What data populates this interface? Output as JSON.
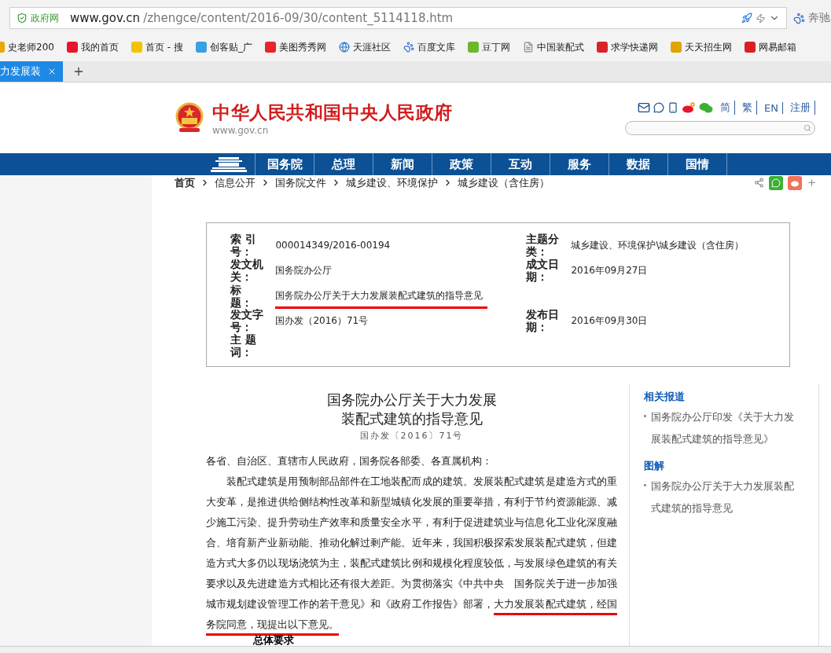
{
  "browser": {
    "site_label": "政府网",
    "url_host": "www.gov.cn",
    "url_path": "/zhengce/content/2016-09/30/content_5114118.htm",
    "search_engine": "奔驰",
    "bookmarks": [
      "史老师200",
      "我的首页",
      "首页 - 搜",
      "创客贴_广",
      "美图秀秀网",
      "天涯社区",
      "百度文库",
      "豆丁网",
      "中国装配式",
      "求学快递网",
      "天天招生网",
      "网易邮箱"
    ],
    "tabs": [
      {
        "title": "力发展装",
        "selected": true
      }
    ]
  },
  "header": {
    "site_title": "中华人民共和国中央人民政府",
    "site_domain": "www.gov.cn",
    "languages": [
      "简",
      "繁",
      "EN",
      "注册"
    ]
  },
  "nav": [
    "国务院",
    "总理",
    "新闻",
    "政策",
    "互动",
    "服务",
    "数据",
    "国情"
  ],
  "breadcrumb": [
    "首页",
    "信息公开",
    "国务院文件",
    "城乡建设、环境保护",
    "城乡建设（含住房）"
  ],
  "info": [
    {
      "label": "索 引号：",
      "value": "000014349/2016-00194",
      "right_label": "主题分类：",
      "right_value": "城乡建设、环境保护\\城乡建设（含住房）"
    },
    {
      "label": "发文机关：",
      "value": "国务院办公厅",
      "right_label": "成文日期：",
      "right_value": "2016年09月27日"
    },
    {
      "label": "标题：",
      "value": "国务院办公厅关于大力发展装配式建筑的指导意见",
      "underlined": true
    },
    {
      "label": "发文字号：",
      "value": "国办发（2016）71号",
      "right_label": "发布日期：",
      "right_value": "2016年09月30日"
    },
    {
      "label": "主 题词："
    }
  ],
  "article": {
    "title_lines": [
      "国务院办公厅关于大力发展",
      "装配式建筑的指导意见"
    ],
    "doc_number": "国办发〔2016〕71号",
    "salutation": "各省、自治区、直辖市人民政府，国务院各部委、各直属机构：",
    "paragraph": [
      {
        "text": "装配式建筑是用预制部品部件在工地装配而成的建筑。发展装配式建筑是建造方式的重大变革，是推进供给侧结构性改革和新型城镇化发展的重要举措，有利于节约资源能源、减少施工污染、提升劳动生产效率和质量安全水平，有利于促进建筑业与信息化工业化深度融合、培育新产业新动能、推动化解过剩产能。近年来，我国积极探索发展装配式建筑，但建造方式大多仍以现场浇筑为主，装配式建筑比例和规模化程度较低，与发展绿色建筑的有关要求以及先进建造方式相比还有很大差距。为贯彻落实《中共中央　国务院关于进一步加强城市规划建设管理工作的若干意见》和《政府工作报告》部署，",
        "underlined": false
      },
      {
        "text": "大力发展装配式建筑，经国务院同意，现提出以下意见。",
        "underlined": true
      }
    ],
    "section_heading": "总体要求"
  },
  "sidebar": [
    {
      "heading": "相关报道",
      "items": [
        "国务院办公厅印发《关于大力发展装配式建筑的指导意见》"
      ]
    },
    {
      "heading": "图解",
      "items": [
        "国务院办公厅关于大力发展装配式建筑的指导意见"
      ]
    }
  ]
}
